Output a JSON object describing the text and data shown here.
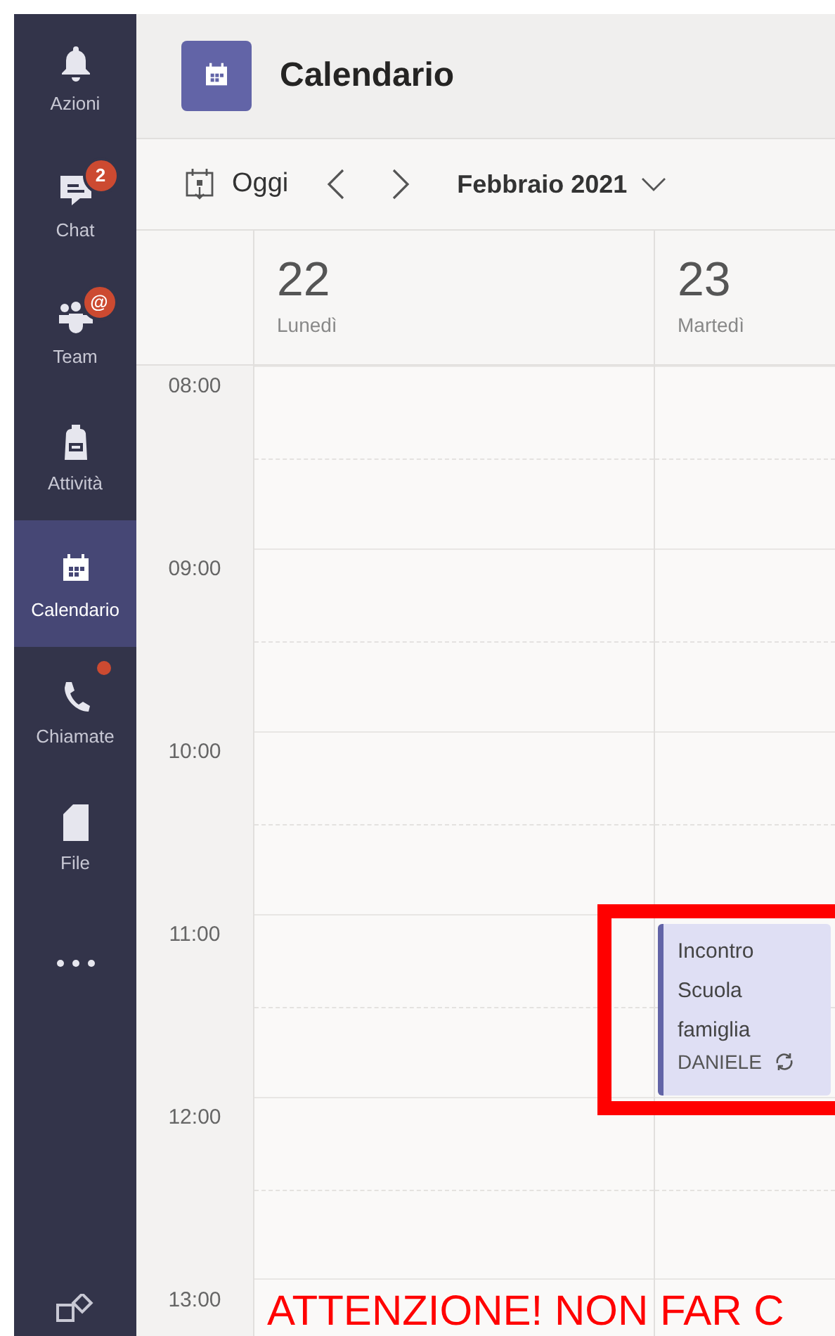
{
  "sidebar": {
    "items": [
      {
        "label": "Azioni",
        "selected": false,
        "dot": false
      },
      {
        "label": "Chat",
        "badge": "2",
        "selected": false,
        "dot": false
      },
      {
        "label": "Team",
        "badge": "@",
        "selected": false,
        "dot": false
      },
      {
        "label": "Attività",
        "selected": false,
        "dot": false
      },
      {
        "label": "Calendario",
        "selected": true,
        "dot": false
      },
      {
        "label": "Chiamate",
        "selected": false,
        "dot": true
      },
      {
        "label": "File",
        "selected": false,
        "dot": false
      }
    ]
  },
  "header": {
    "title": "Calendario"
  },
  "toolbar": {
    "today": "Oggi",
    "month": "Febbraio 2021"
  },
  "days": [
    {
      "number": "22",
      "weekday": "Lunedì"
    },
    {
      "number": "23",
      "weekday": "Martedì"
    }
  ],
  "hours": [
    "08:00",
    "09:00",
    "10:00",
    "11:00",
    "12:00",
    "13:00"
  ],
  "event": {
    "title": "Incontro Scuola famiglia",
    "organizer": "DANIELE",
    "recurring": true
  },
  "annotation": {
    "text": "ATTENZIONE! NON FAR C"
  }
}
